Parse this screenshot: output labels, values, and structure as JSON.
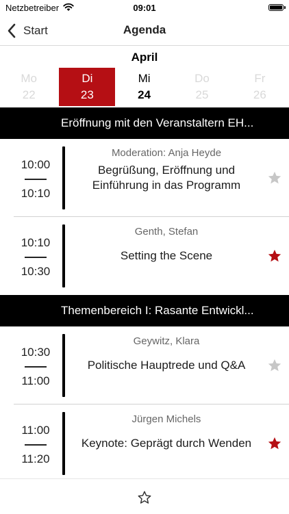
{
  "status": {
    "carrier": "Netzbetreiber",
    "time": "09:01"
  },
  "nav": {
    "back_label": "Start",
    "title": "Agenda"
  },
  "calendar": {
    "month": "April",
    "days": [
      {
        "name": "Mo",
        "date": "22"
      },
      {
        "name": "Di",
        "date": "23"
      },
      {
        "name": "Mi",
        "date": "24"
      },
      {
        "name": "Do",
        "date": "25"
      },
      {
        "name": "Fr",
        "date": "26"
      }
    ]
  },
  "sections": [
    {
      "title": "Eröffnung mit den Veranstaltern EH..."
    },
    {
      "title": "Themenbereich I: Rasante Entwickl..."
    }
  ],
  "sessions": [
    {
      "start": "10:00",
      "end": "10:10",
      "speaker": "Moderation: Anja Heyde",
      "title_line1": "Begrüßung, Eröffnung und",
      "title_line2": "Einführung in das Programm",
      "starred": false
    },
    {
      "start": "10:10",
      "end": "10:30",
      "speaker": "Genth, Stefan",
      "title": "Setting the Scene",
      "starred": true
    },
    {
      "start": "10:30",
      "end": "11:00",
      "speaker": "Geywitz, Klara",
      "title": "Politische Hauptrede und Q&A",
      "starred": false
    },
    {
      "start": "11:00",
      "end": "11:20",
      "speaker": "Jürgen Michels",
      "title": "Keynote: Geprägt durch Wenden",
      "starred": true
    }
  ],
  "colors": {
    "accent": "#b50f14",
    "star_active": "#b50f14",
    "star_inactive": "#c7c7c7",
    "disabled": "#d9d9d9"
  },
  "icons": {
    "back": "chevron-left-icon",
    "favorite": "star-icon",
    "favorites_tab": "star-outline-icon"
  }
}
